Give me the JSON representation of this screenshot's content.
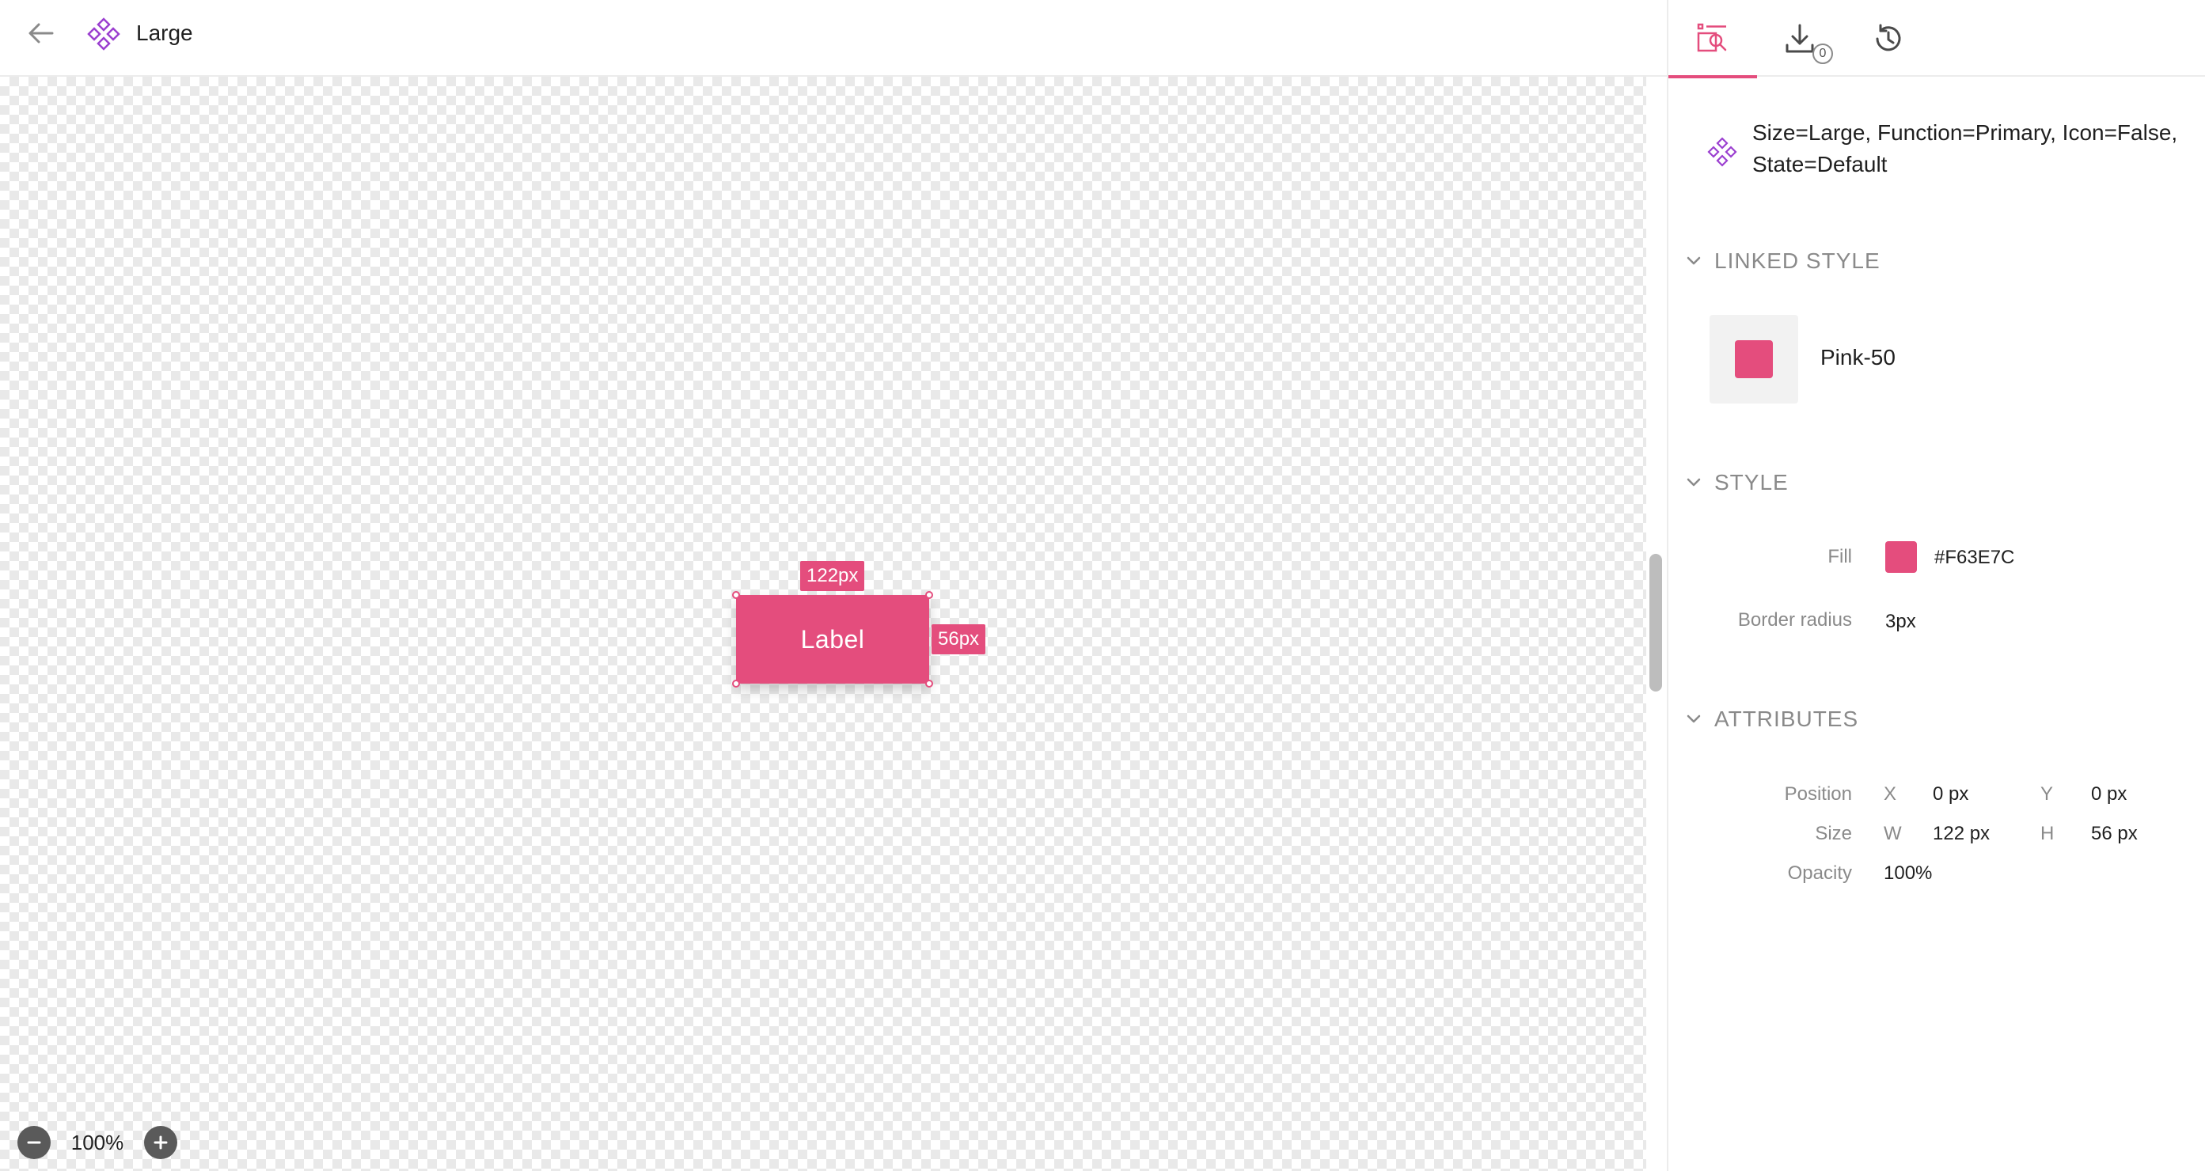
{
  "header": {
    "title": "Large",
    "back_icon": "arrow-left-icon",
    "component_icon": "component-diamond-icon"
  },
  "canvas": {
    "component_label": "Label",
    "width_badge": "122px",
    "height_badge": "56px",
    "zoom": "100%"
  },
  "tabs": [
    {
      "name": "inspect",
      "icon": "inspect-icon",
      "active": true
    },
    {
      "name": "export",
      "icon": "download-icon",
      "badge": "0"
    },
    {
      "name": "history",
      "icon": "history-icon"
    }
  ],
  "inspector": {
    "variant_name": "Size=Large, Function=Primary, Icon=False, State=Default",
    "linked_style": {
      "title": "LINKED STYLE",
      "name": "Pink-50"
    },
    "style": {
      "title": "STYLE",
      "fill_label": "Fill",
      "fill_value": "#F63E7C",
      "radius_label": "Border radius",
      "radius_value": "3px"
    },
    "attributes": {
      "title": "ATTRIBUTES",
      "position_label": "Position",
      "x_label": "X",
      "x_value": "0 px",
      "y_label": "Y",
      "y_value": "0 px",
      "size_label": "Size",
      "w_label": "W",
      "w_value": "122 px",
      "h_label": "H",
      "h_value": "56 px",
      "opacity_label": "Opacity",
      "opacity_value": "100%"
    }
  },
  "colors": {
    "accent": "#e44d7d",
    "component_icon": "#9b3fd0"
  }
}
